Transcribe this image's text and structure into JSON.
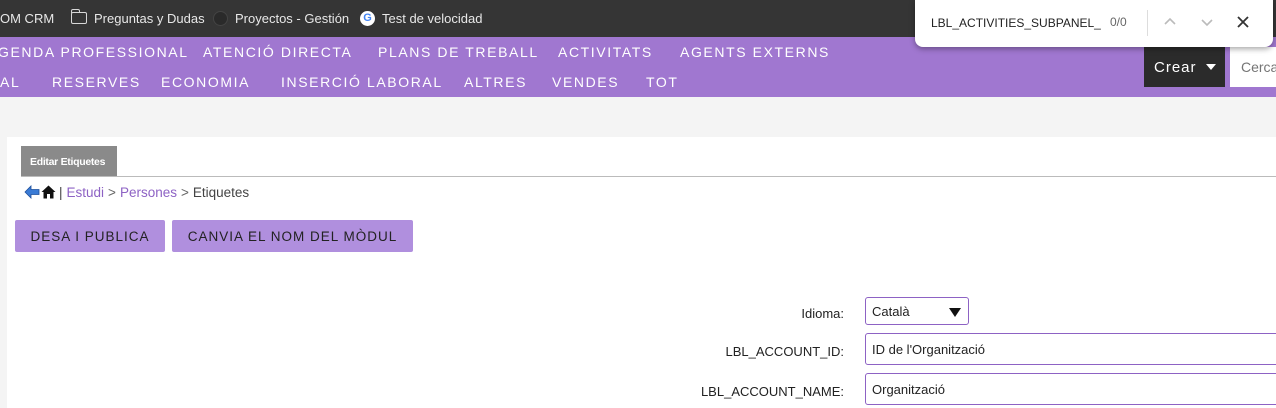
{
  "bookmarks": [
    {
      "label": "OM CRM",
      "icon": "none"
    },
    {
      "label": "Preguntas y Dudas",
      "icon": "folder-icon"
    },
    {
      "label": "Proyectos - Gestión",
      "icon": "globe-icon"
    },
    {
      "label": "Test de velocidad",
      "icon": "google-icon"
    }
  ],
  "find_bar": {
    "query": "LBL_ACTIVITIES_SUBPANEL_TI",
    "count": "0/0",
    "prev_icon": "chevron-up-icon",
    "next_icon": "chevron-down-icon",
    "close_icon": "close-icon"
  },
  "nav": {
    "row1": [
      "GENDA PROFESSIONAL",
      "ATENCIÓ DIRECTA",
      "PLANS DE TREBALL",
      "ACTIVITATS",
      "AGENTS EXTERNS"
    ],
    "row2": [
      "AL",
      "RESERVES",
      "ECONOMIA",
      "INSERCIÓ LABORAL",
      "ALTRES",
      "VENDES",
      "TOT"
    ],
    "create_label": "Crear",
    "search_placeholder": "Cerca"
  },
  "tab": {
    "label": "Editar Etiquetes"
  },
  "breadcrumb": {
    "sep1": "|",
    "studio": "Estudi",
    "sep2": ">",
    "module": "Persones",
    "sep3": ">",
    "current": "Etiquetes"
  },
  "buttons": {
    "save_publish": "DESA I PUBLICA",
    "rename_module": "CANVIA EL NOM DEL MÒDUL"
  },
  "form": {
    "language_label": "Idioma:",
    "language_value": "Català",
    "fields": [
      {
        "label": "LBL_ACCOUNT_ID:",
        "value": "ID de l'Organització"
      },
      {
        "label": "LBL_ACCOUNT_NAME:",
        "value": "Organització"
      }
    ]
  },
  "colors": {
    "accent": "#a077d0",
    "button": "#b08fde",
    "link": "#8d62c4",
    "dark": "#353535"
  }
}
